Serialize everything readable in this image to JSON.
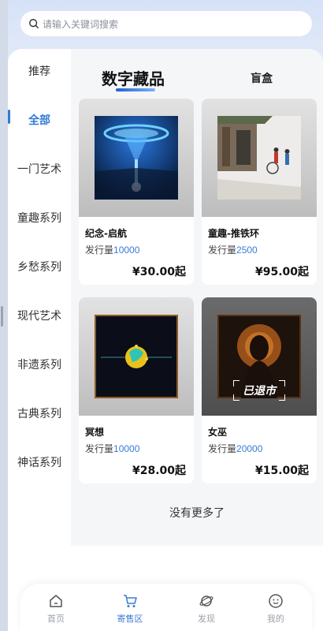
{
  "search": {
    "placeholder": "请输入关键词搜索"
  },
  "sidebar": {
    "items": [
      {
        "label": "推荐"
      },
      {
        "label": "全部"
      },
      {
        "label": "一门艺术"
      },
      {
        "label": "童趣系列"
      },
      {
        "label": "乡愁系列"
      },
      {
        "label": "现代艺术"
      },
      {
        "label": "非遗系列"
      },
      {
        "label": "古典系列"
      },
      {
        "label": "神话系列"
      }
    ],
    "active": "全部"
  },
  "tabs": {
    "active": "数字藏品",
    "other": "盲盒"
  },
  "issue_label": "发行量",
  "products": [
    {
      "name": "纪念-启航",
      "issue": "10000",
      "price": "¥30.00起",
      "status": ""
    },
    {
      "name": "童趣-推铁环",
      "issue": "2500",
      "price": "¥95.00起",
      "status": ""
    },
    {
      "name": "冥想",
      "issue": "10000",
      "price": "¥28.00起",
      "status": ""
    },
    {
      "name": "女巫",
      "issue": "20000",
      "price": "¥15.00起",
      "status": "已退市"
    }
  ],
  "no_more": "没有更多了",
  "tabbar": {
    "items": [
      {
        "label": "首页",
        "icon": "home-icon"
      },
      {
        "label": "寄售区",
        "icon": "cart-icon"
      },
      {
        "label": "发现",
        "icon": "planet-icon"
      },
      {
        "label": "我的",
        "icon": "smiley-icon"
      }
    ],
    "active": "寄售区"
  },
  "colors": {
    "accent": "#3a7bd5",
    "active_side": "#2f7bd6"
  }
}
